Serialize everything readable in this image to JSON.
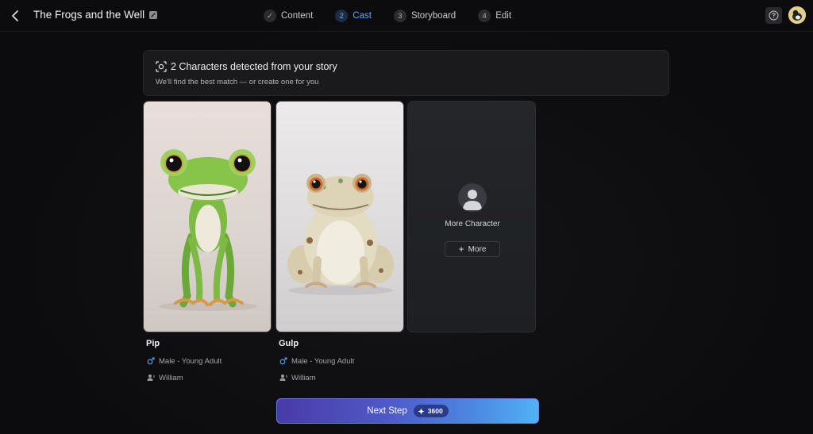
{
  "header": {
    "project_title": "The Frogs and the Well",
    "steps": [
      {
        "number": "✓",
        "label": "Content",
        "state": "done"
      },
      {
        "number": "2",
        "label": "Cast",
        "state": "active"
      },
      {
        "number": "3",
        "label": "Storyboard",
        "state": "todo"
      },
      {
        "number": "4",
        "label": "Edit",
        "state": "todo"
      }
    ],
    "help_icon": "question-circle-icon",
    "accent_color": "#5ea1ff"
  },
  "banner": {
    "title": "2 Characters detected from your story",
    "subtitle": "We'll find the best match — or create one for you",
    "icon": "face-scan-icon"
  },
  "characters": [
    {
      "name": "Pip",
      "gender_age": "Male - Young Adult",
      "voice": "William"
    },
    {
      "name": "Gulp",
      "gender_age": "Male - Young Adult",
      "voice": "William"
    }
  ],
  "more_card": {
    "label": "More Character",
    "button_label": "More"
  },
  "footer": {
    "next_label": "Next Step",
    "credits": "3600"
  }
}
